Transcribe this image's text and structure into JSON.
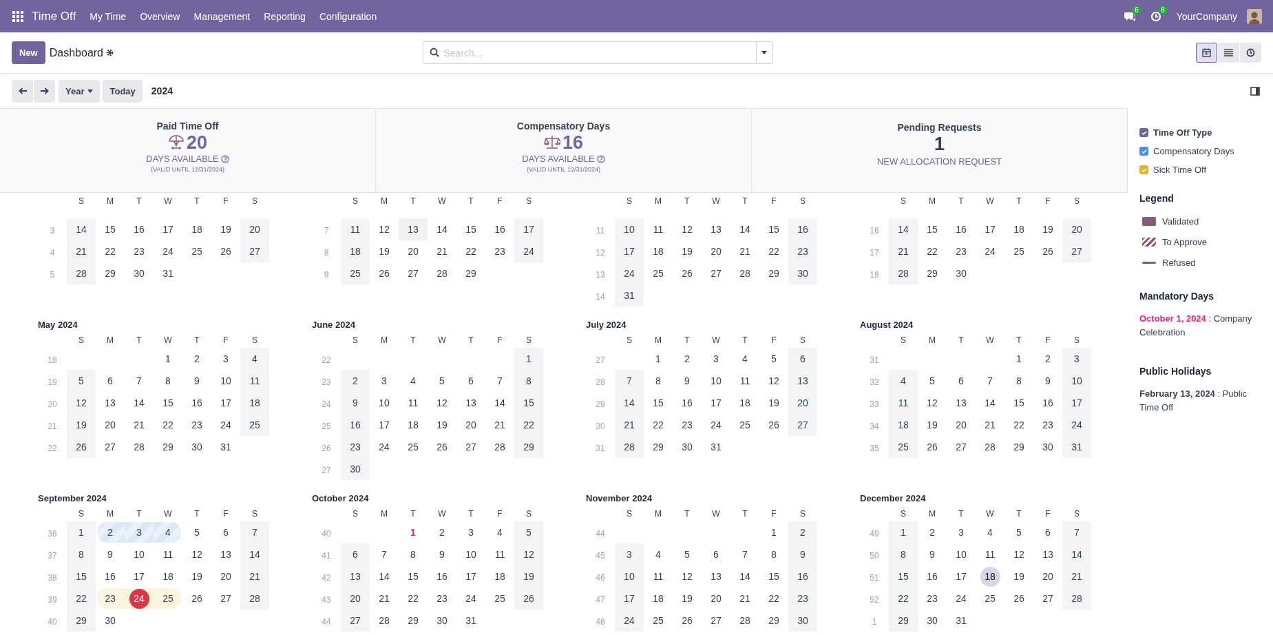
{
  "navbar": {
    "app": "Time Off",
    "menu": [
      "My Time",
      "Overview",
      "Management",
      "Reporting",
      "Configuration"
    ],
    "messages_badge": "6",
    "activities_badge": "8",
    "company": "YourCompany"
  },
  "control_panel": {
    "new_button": "New",
    "title": "Dashboard",
    "search": {
      "placeholder": "Search..."
    },
    "views": [
      {
        "kind": "calendar",
        "selected": true
      },
      {
        "kind": "list",
        "selected": false
      },
      {
        "kind": "activity",
        "selected": false
      }
    ],
    "period_button": "Year",
    "today_button": "Today",
    "period": "2024"
  },
  "cards": [
    {
      "kind": "allocation",
      "title": "Paid Time Off",
      "value": "20",
      "caption": "DAYS AVAILABLE",
      "note": "(VALID UNTIL 12/31/2024)"
    },
    {
      "kind": "allocation",
      "title": "Compensatory Days",
      "value": "16",
      "caption": "DAYS AVAILABLE",
      "note": "(VALID UNTIL 12/31/2024)"
    },
    {
      "kind": "pending",
      "title": "Pending Requests",
      "value": "1",
      "link": "NEW ALLOCATION REQUEST"
    }
  ],
  "months": [
    {
      "weekdays": [
        "S",
        "M",
        "T",
        "W",
        "T",
        "F",
        "S"
      ],
      "weeks": [
        {
          "number": "3",
          "days": [
            "14",
            "15",
            "16",
            "17",
            "18",
            "19",
            "20"
          ]
        },
        {
          "number": "4",
          "days": [
            "21",
            "22",
            "23",
            "24",
            "25",
            "26",
            "27"
          ]
        },
        {
          "number": "5",
          "days": [
            "28",
            "29",
            "30",
            "31"
          ]
        }
      ]
    },
    {
      "weekdays": [
        "S",
        "M",
        "T",
        "W",
        "T",
        "F",
        "S"
      ],
      "weeks": [
        {
          "number": "7",
          "days": [
            "11",
            "12",
            {
              "text": "13",
              "kind": "holiday",
              "today": false
            },
            "14",
            "15",
            "16",
            "17"
          ]
        },
        {
          "number": "8",
          "days": [
            "18",
            "19",
            "20",
            "21",
            "22",
            "23",
            "24"
          ]
        },
        {
          "number": "9",
          "days": [
            "25",
            "26",
            "27",
            "28",
            "29"
          ]
        }
      ]
    },
    {
      "weekdays": [
        "S",
        "M",
        "T",
        "W",
        "T",
        "F",
        "S"
      ],
      "weeks": [
        {
          "number": "11",
          "days": [
            "10",
            "11",
            "12",
            "13",
            "14",
            "15",
            "16"
          ]
        },
        {
          "number": "12",
          "days": [
            "17",
            "18",
            "19",
            "20",
            "21",
            "22",
            "23"
          ]
        },
        {
          "number": "13",
          "days": [
            "24",
            "25",
            "26",
            "27",
            "28",
            "29",
            "30"
          ]
        },
        {
          "number": "14",
          "days": [
            "31"
          ]
        }
      ]
    },
    {
      "weekdays": [
        "S",
        "M",
        "T",
        "W",
        "T",
        "F",
        "S"
      ],
      "weeks": [
        {
          "number": "16",
          "days": [
            "14",
            "15",
            "16",
            "17",
            "18",
            "19",
            "20"
          ]
        },
        {
          "number": "17",
          "days": [
            "21",
            "22",
            "23",
            "24",
            "25",
            "26",
            "27"
          ]
        },
        {
          "number": "18",
          "days": [
            "28",
            "29",
            "30"
          ]
        }
      ]
    },
    {
      "title": "May 2024",
      "weekdays": [
        "S",
        "M",
        "T",
        "W",
        "T",
        "F",
        "S"
      ],
      "weeks": [
        {
          "number": "18",
          "days": [
            "1",
            "2",
            "3",
            "4"
          ]
        },
        {
          "number": "19",
          "days": [
            "5",
            "6",
            "7",
            "8",
            "9",
            "10",
            "11"
          ]
        },
        {
          "number": "20",
          "days": [
            "12",
            "13",
            "14",
            "15",
            "16",
            "17",
            "18"
          ]
        },
        {
          "number": "21",
          "days": [
            "19",
            "20",
            "21",
            "22",
            "23",
            "24",
            "25"
          ]
        },
        {
          "number": "22",
          "days": [
            "26",
            "27",
            "28",
            "29",
            "30",
            "31"
          ]
        }
      ]
    },
    {
      "title": "June 2024",
      "weekdays": [
        "S",
        "M",
        "T",
        "W",
        "T",
        "F",
        "S"
      ],
      "weeks": [
        {
          "number": "22",
          "days": [
            "1"
          ]
        },
        {
          "number": "23",
          "days": [
            "2",
            "3",
            "4",
            "5",
            "6",
            "7",
            "8"
          ]
        },
        {
          "number": "24",
          "days": [
            "9",
            "10",
            "11",
            "12",
            "13",
            "14",
            "15"
          ]
        },
        {
          "number": "25",
          "days": [
            "16",
            "17",
            "18",
            "19",
            "20",
            "21",
            "22"
          ]
        },
        {
          "number": "26",
          "days": [
            "23",
            "24",
            "25",
            "26",
            "27",
            "28",
            "29"
          ]
        },
        {
          "number": "27",
          "days": [
            "30"
          ]
        }
      ]
    },
    {
      "title": "July 2024",
      "weekdays": [
        "S",
        "M",
        "T",
        "W",
        "T",
        "F",
        "S"
      ],
      "weeks": [
        {
          "number": "27",
          "days": [
            "1",
            "2",
            "3",
            "4",
            "5",
            "6"
          ]
        },
        {
          "number": "28",
          "days": [
            "7",
            "8",
            "9",
            "10",
            "11",
            "12",
            "13"
          ]
        },
        {
          "number": "29",
          "days": [
            "14",
            "15",
            "16",
            "17",
            "18",
            "19",
            "20"
          ]
        },
        {
          "number": "30",
          "days": [
            "21",
            "22",
            "23",
            "24",
            "25",
            "26",
            "27"
          ]
        },
        {
          "number": "31",
          "days": [
            "28",
            "29",
            "30",
            "31"
          ]
        }
      ]
    },
    {
      "title": "August 2024",
      "weekdays": [
        "S",
        "M",
        "T",
        "W",
        "T",
        "F",
        "S"
      ],
      "weeks": [
        {
          "number": "31",
          "days": [
            "1",
            "2",
            "3"
          ]
        },
        {
          "number": "32",
          "days": [
            "4",
            "5",
            "6",
            "7",
            "8",
            "9",
            "10"
          ]
        },
        {
          "number": "33",
          "days": [
            "11",
            "12",
            "13",
            "14",
            "15",
            "16",
            "17"
          ]
        },
        {
          "number": "34",
          "days": [
            "18",
            "19",
            "20",
            "21",
            "22",
            "23",
            "24"
          ]
        },
        {
          "number": "35",
          "days": [
            "25",
            "26",
            "27",
            "28",
            "29",
            "30",
            "31"
          ]
        }
      ]
    },
    {
      "title": "September 2024",
      "weekdays": [
        "S",
        "M",
        "T",
        "W",
        "T",
        "F",
        "S"
      ],
      "weeks": [
        {
          "number": "36",
          "days": [
            "1",
            {
              "text": "2",
              "kind": "to-approve",
              "today": false
            },
            {
              "text": "3",
              "kind": "to-approve",
              "today": false
            },
            {
              "text": "4",
              "kind": "to-approve",
              "today": false
            },
            "5",
            "6",
            "7"
          ]
        },
        {
          "number": "37",
          "days": [
            "8",
            "9",
            "10",
            "11",
            "12",
            "13",
            "14"
          ]
        },
        {
          "number": "38",
          "days": [
            "15",
            "16",
            "17",
            "18",
            "19",
            "20",
            "21"
          ]
        },
        {
          "number": "39",
          "days": [
            "22",
            {
              "text": "23",
              "kind": "sick",
              "today": false
            },
            {
              "text": "24",
              "kind": "sick",
              "today": true
            },
            {
              "text": "25",
              "kind": "sick",
              "today": false
            },
            "26",
            "27",
            "28"
          ]
        },
        {
          "number": "40",
          "days": [
            "29",
            "30"
          ]
        }
      ]
    },
    {
      "title": "October 2024",
      "weekdays": [
        "S",
        "M",
        "T",
        "W",
        "T",
        "F",
        "S"
      ],
      "weeks": [
        {
          "number": "40",
          "days": [
            {
              "text": "1",
              "kind": "mandatory",
              "today": false
            },
            "2",
            "3",
            "4",
            "5"
          ]
        },
        {
          "number": "41",
          "days": [
            "6",
            "7",
            "8",
            "9",
            "10",
            "11",
            "12"
          ]
        },
        {
          "number": "42",
          "days": [
            "13",
            "14",
            "15",
            "16",
            "17",
            "18",
            "19"
          ]
        },
        {
          "number": "43",
          "days": [
            "20",
            "21",
            "22",
            "23",
            "24",
            "25",
            "26"
          ]
        },
        {
          "number": "44",
          "days": [
            "27",
            "28",
            "29",
            "30",
            "31"
          ]
        }
      ]
    },
    {
      "title": "November 2024",
      "weekdays": [
        "S",
        "M",
        "T",
        "W",
        "T",
        "F",
        "S"
      ],
      "weeks": [
        {
          "number": "44",
          "days": [
            "1",
            "2"
          ]
        },
        {
          "number": "45",
          "days": [
            "3",
            "4",
            "5",
            "6",
            "7",
            "8",
            "9"
          ]
        },
        {
          "number": "46",
          "days": [
            "10",
            "11",
            "12",
            "13",
            "14",
            "15",
            "16"
          ]
        },
        {
          "number": "47",
          "days": [
            "17",
            "18",
            "19",
            "20",
            "21",
            "22",
            "23"
          ]
        },
        {
          "number": "48",
          "days": [
            "24",
            "25",
            "26",
            "27",
            "28",
            "29",
            "30"
          ]
        }
      ]
    },
    {
      "title": "December 2024",
      "weekdays": [
        "S",
        "M",
        "T",
        "W",
        "T",
        "F",
        "S"
      ],
      "weeks": [
        {
          "number": "49",
          "days": [
            "1",
            "2",
            "3",
            "4",
            "5",
            "6",
            "7"
          ]
        },
        {
          "number": "50",
          "days": [
            "8",
            "9",
            "10",
            "11",
            "12",
            "13",
            "14"
          ]
        },
        {
          "number": "51",
          "days": [
            "15",
            "16",
            "17",
            {
              "text": "18",
              "kind": "focus",
              "today": false
            },
            "19",
            "20",
            "21"
          ]
        },
        {
          "number": "52",
          "days": [
            "22",
            "23",
            "24",
            "25",
            "26",
            "27",
            "28"
          ]
        },
        {
          "number": "1",
          "days": [
            "29",
            "30",
            "31"
          ]
        }
      ]
    }
  ],
  "sidebar": {
    "filters": [
      {
        "label": "Time Off Type",
        "checked": true,
        "color": "#71639e"
      },
      {
        "label": "Compensatory Days",
        "checked": true,
        "color": "#4a90e2"
      },
      {
        "label": "Sick Time Off",
        "checked": true,
        "color": "#e9b22b"
      }
    ],
    "legend_title": "Legend",
    "legend": [
      {
        "label": "Validated",
        "kind": "validated"
      },
      {
        "label": "To Approve",
        "kind": "to-approve"
      },
      {
        "label": "Refused",
        "kind": "refused"
      }
    ],
    "mandatory_title": "Mandatory Days",
    "mandatory": [
      "**October 1, 2024** : Company Celebration"
    ],
    "holidays_title": "Public Holidays",
    "holidays": [
      "**February 13, 2024** : Public Time Off"
    ]
  }
}
